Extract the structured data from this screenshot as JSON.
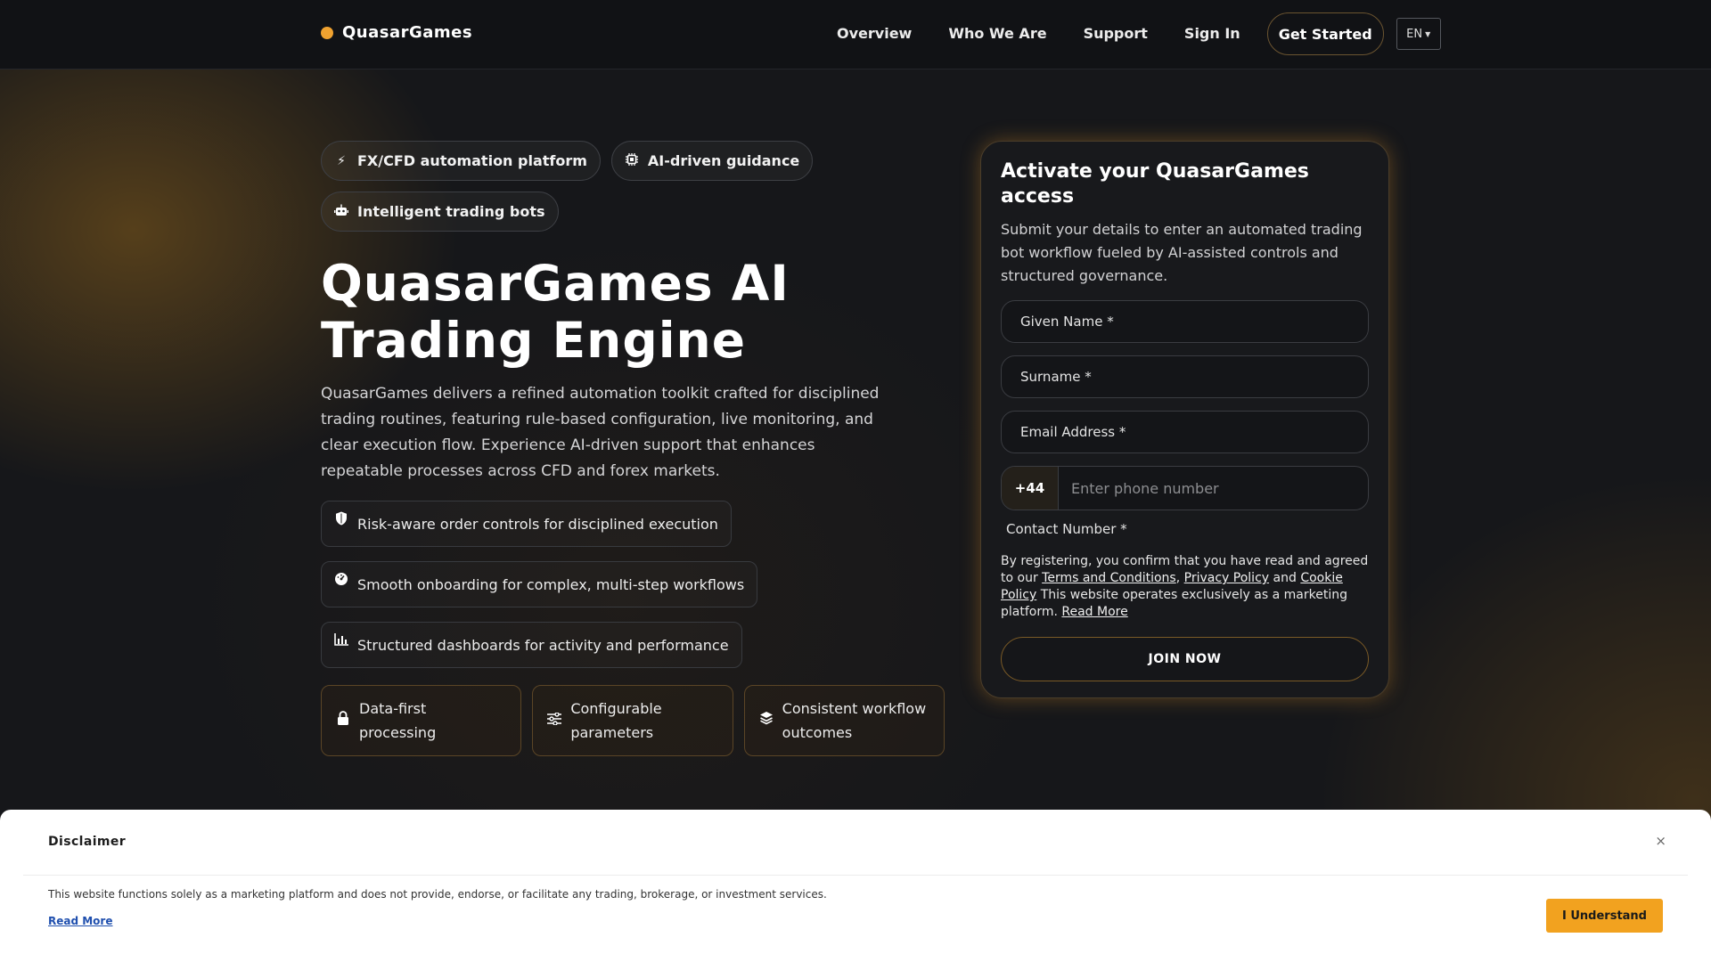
{
  "header": {
    "brand": "QuasarGames",
    "nav": [
      "Overview",
      "Who We Are",
      "Support",
      "Sign In"
    ],
    "cta": "Get Started",
    "lang": "EN"
  },
  "hero": {
    "chips": [
      {
        "icon": "bolt-icon",
        "label": "FX/CFD automation platform"
      },
      {
        "icon": "chip-icon",
        "label": "AI-driven guidance"
      },
      {
        "icon": "robot-icon",
        "label": "Intelligent trading bots"
      }
    ],
    "title": "QuasarGames AI Trading Engine",
    "description": "QuasarGames delivers a refined automation toolkit crafted for disciplined trading routines, featuring rule-based configuration, live monitoring, and clear execution flow. Experience AI-driven support that enhances repeatable processes across CFD and forex markets.",
    "features": [
      {
        "icon": "shield-icon",
        "label": "Risk-aware order controls for disciplined execution"
      },
      {
        "icon": "gauge-icon",
        "label": "Smooth onboarding for complex, multi-step workflows"
      },
      {
        "icon": "bar-chart-icon",
        "label": "Structured dashboards for activity and performance"
      }
    ],
    "tiles": [
      {
        "icon": "lock-icon",
        "label": "Data-first processing"
      },
      {
        "icon": "sliders-icon",
        "label": "Configurable parameters"
      },
      {
        "icon": "layers-icon",
        "label": "Consistent workflow outcomes"
      }
    ]
  },
  "form": {
    "title": "Activate your QuasarGames access",
    "description": "Submit your details to enter an automated trading bot workflow fueled by AI-assisted controls and structured governance.",
    "given_name_placeholder": "Given Name *",
    "surname_placeholder": "Surname *",
    "email_placeholder": "Email Address *",
    "phone_code": "+44",
    "phone_placeholder": "Enter phone number",
    "phone_label": "Contact Number *",
    "consent": {
      "prefix": "By registering, you confirm that you have read and agreed to our ",
      "terms": "Terms and Conditions",
      "sep1": ", ",
      "privacy": "Privacy Policy",
      "sep2": " and ",
      "cookie": "Cookie Policy",
      "suffix": " This website operates exclusively as a marketing platform. ",
      "read_more": "Read More"
    },
    "submit": "JOIN NOW"
  },
  "disclaimer": {
    "title": "Disclaimer",
    "close": "×",
    "text": "This website functions solely as a marketing platform and does not provide, endorse, or facilitate any trading, brokerage, or investment services.",
    "read_more": "Read More",
    "button": "I Understand"
  },
  "colors": {
    "accent": "#f2a21f",
    "background": "#16171a"
  }
}
